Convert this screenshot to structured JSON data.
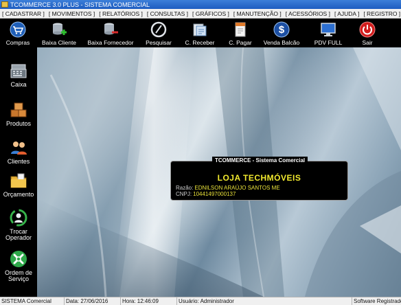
{
  "window": {
    "title": "TCOMMERCE 3.0 PLUS - SISTEMA COMERCIAL"
  },
  "menu": [
    "[ CADASTRAR ]",
    "[ MOVIMENTOS ]",
    "[ RELATÓRIOS ]",
    "[ CONSULTAS ]",
    "[ GRÁFICOS ]",
    "[ MANUTENÇÃO ]",
    "[ ACESSÓRIOS ]",
    "[ AJUDA ]",
    "[ REGISTRO ]"
  ],
  "toolbar": [
    {
      "label": "Compras",
      "icon": "cart-icon"
    },
    {
      "label": "Baixa Cliente",
      "icon": "database-add-icon"
    },
    {
      "label": "Baixa Fornecedor",
      "icon": "database-remove-icon"
    },
    {
      "label": "Pesquisar",
      "icon": "search-icon"
    },
    {
      "label": "C. Receber",
      "icon": "receive-icon"
    },
    {
      "label": "C. Pagar",
      "icon": "pay-document-icon"
    },
    {
      "label": "Venda Balcão",
      "icon": "dollar-icon"
    },
    {
      "label": "PDV FULL",
      "icon": "monitor-icon"
    },
    {
      "label": "Sair",
      "icon": "power-icon"
    }
  ],
  "sidebar": [
    {
      "label": "Caixa",
      "icon": "cash-register-icon"
    },
    {
      "label": "Produtos",
      "icon": "boxes-icon"
    },
    {
      "label": "Clientes",
      "icon": "users-icon"
    },
    {
      "label": "Orçamento",
      "icon": "folder-icon"
    },
    {
      "label": "Trocar Operador",
      "icon": "recycle-user-icon"
    },
    {
      "label": "Ordem de Serviço",
      "icon": "tools-icon"
    }
  ],
  "info_panel": {
    "title": "TCOMMERCE - Sistema Comercial",
    "store_name": "LOJA TECHMÓVEIS",
    "razao_label": "Razão:",
    "razao_value": "EDNILSON ARAÚJO SANTOS ME",
    "cnpj_label": "CNPJ:",
    "cnpj_value": "10441497000137"
  },
  "status": {
    "system": "SISTEMA Comercial",
    "date": "Data: 27/06/2016",
    "time": "Hora: 12:46:09",
    "user": "Usuário: Administrador",
    "registration": "Software Registrado"
  },
  "colors": {
    "accent_yellow": "#f2ea2e",
    "titlebar_blue": "#1d5cc0",
    "background": "#000000"
  }
}
